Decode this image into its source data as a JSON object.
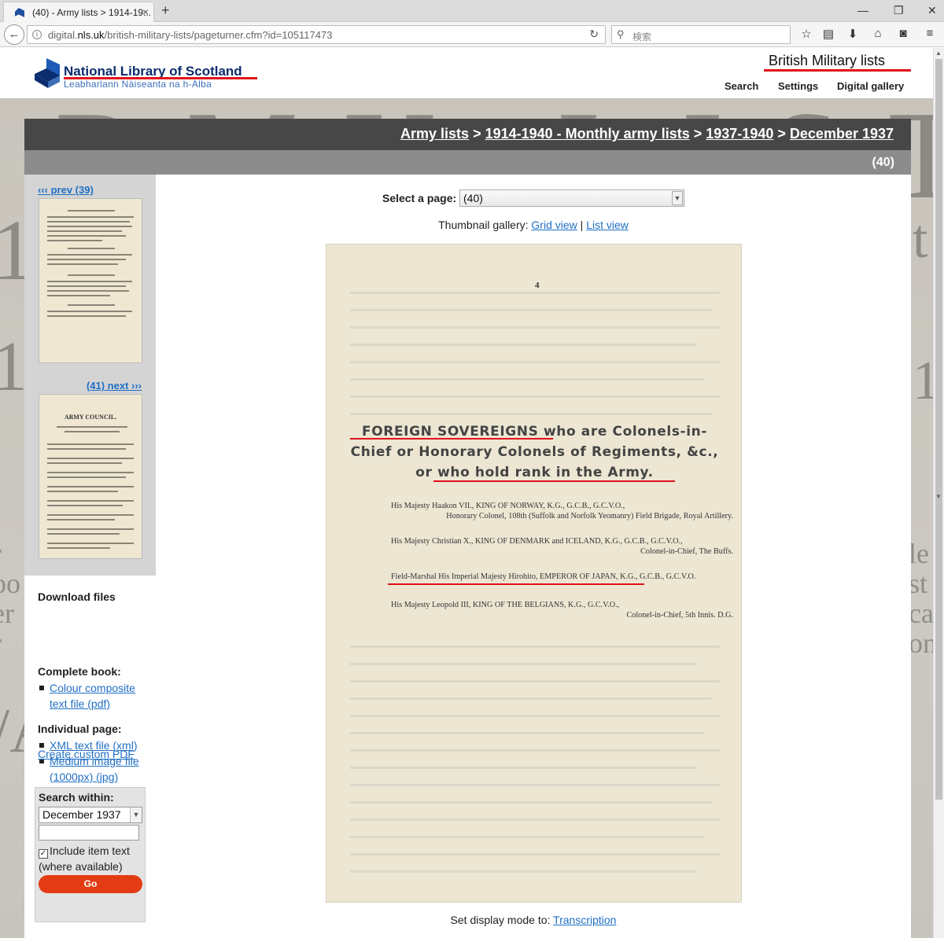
{
  "browser": {
    "tab_title": "(40) - Army lists > 1914-19...",
    "url_prefix": "digital.",
    "url_domain": "nls.uk",
    "url_path": "/british-military-lists/pageturner.cfm?id=105117473",
    "search_placeholder": "検索"
  },
  "header": {
    "logo_title": "National Library of Scotland",
    "logo_subtitle": "Leabharlann Nàiseanta na h-Alba",
    "site_name": "British Military lists",
    "nav": [
      "Search",
      "Settings",
      "Digital gallery"
    ]
  },
  "breadcrumb": {
    "items": [
      "Army lists",
      "1914-1940 - Monthly army lists",
      "1937-1940",
      "December 1937"
    ],
    "separator": ">",
    "page_indicator": "(40)"
  },
  "sidebar": {
    "prev_label": "‹‹‹ prev (39)",
    "next_label": "(41) next ›››",
    "next_thumb_heading": "ARMY COUNCIL.",
    "download_heading": "Download files",
    "complete_book_label": "Complete book:",
    "complete_book_links": [
      "Colour composite text file (pdf)"
    ],
    "individual_page_label": "Individual page:",
    "individual_page_links": [
      "XML text file (xml)",
      "Medium image file (1000px) (jpg)"
    ],
    "custom_pdf": "Create custom PDF",
    "search_within_label": "Search within:",
    "search_within_value": "December 1937",
    "include_text_label": "Include item text (where available)",
    "go_label": "Go"
  },
  "main": {
    "select_label": "Select a page:",
    "select_value": "(40)",
    "thumb_gallery_label": "Thumbnail gallery:",
    "grid_view": "Grid view",
    "separator": "|",
    "list_view": "List view",
    "display_mode_label": "Set display mode to:",
    "display_mode_link": "Transcription"
  },
  "scan": {
    "page_number": "4",
    "heading_lines": [
      "FOREIGN SOVEREIGNS who are Colonels-in-",
      "Chief or Honorary Colonels of Regiments, &c.,",
      "or who hold rank in the Army."
    ],
    "entries": [
      {
        "line1": "His Majesty Haakon VII., KING OF NORWAY, K.G., G.C.B., G.C.V.O.,",
        "line2": "Honorary Colonel, 108th (Suffolk and Norfolk Yeomanry) Field Brigade, Royal Artillery."
      },
      {
        "line1": "His Majesty Christian X., KING OF DENMARK and ICELAND, K.G., G.C.B., G.C.V.O.,",
        "line2": "Colonel-in-Chief, The Buffs."
      },
      {
        "line1": "Field-Marshal His Imperial Majesty Hirohito, EMPEROR OF JAPAN, K.G., G.C.B., G.C.V.O.",
        "line2": ""
      },
      {
        "line1": "His Majesty Leopold III, KING OF THE BELGIANS, K.G., G.C.V.O.,",
        "line2": "Colonel-in-Chief, 5th Innis. D.G."
      }
    ]
  },
  "colors": {
    "accent_red": "#e0121b",
    "link_blue": "#1f6fc5",
    "breadcrumb_bg": "#474747",
    "go_button": "#e33c14"
  }
}
